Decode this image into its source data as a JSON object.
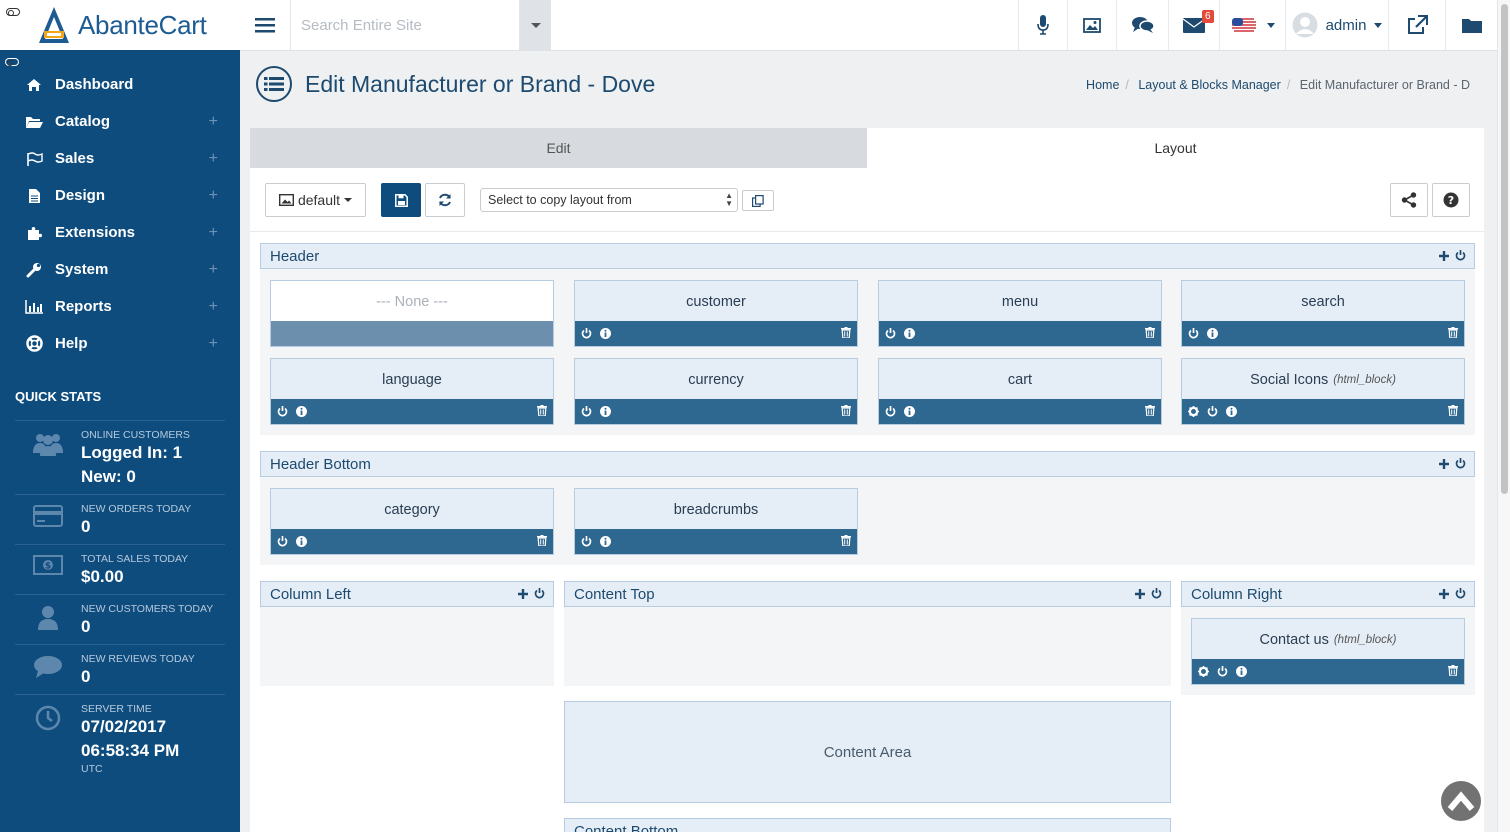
{
  "brand": {
    "name": "AbanteCart"
  },
  "sidebar": {
    "menu": [
      {
        "label": "Dashboard",
        "icon": "home-icon",
        "expandable": false
      },
      {
        "label": "Catalog",
        "icon": "folder-open-icon",
        "expandable": true
      },
      {
        "label": "Sales",
        "icon": "flag-icon",
        "expandable": true
      },
      {
        "label": "Design",
        "icon": "file-icon",
        "expandable": true
      },
      {
        "label": "Extensions",
        "icon": "puzzle-icon",
        "expandable": true
      },
      {
        "label": "System",
        "icon": "wrench-icon",
        "expandable": true
      },
      {
        "label": "Reports",
        "icon": "bar-chart-icon",
        "expandable": true
      },
      {
        "label": "Help",
        "icon": "lifebuoy-icon",
        "expandable": true
      }
    ],
    "expand_symbol": "+",
    "quick_stats": {
      "title": "QUICK STATS",
      "online": {
        "label": "ONLINE CUSTOMERS",
        "logged_in": "Logged In: 1",
        "new": "New: 0"
      },
      "orders": {
        "label": "NEW ORDERS TODAY",
        "value": "0"
      },
      "sales": {
        "label": "TOTAL SALES TODAY",
        "value": "$0.00"
      },
      "customers": {
        "label": "NEW CUSTOMERS TODAY",
        "value": "0"
      },
      "reviews": {
        "label": "NEW REVIEWS TODAY",
        "value": "0"
      },
      "server_time": {
        "label": "SERVER TIME",
        "date": "07/02/2017",
        "time": "06:58:34 PM",
        "tz": "UTC"
      }
    }
  },
  "topbar": {
    "search_placeholder": "Search Entire Site",
    "messages_badge": "6",
    "user": "admin"
  },
  "page": {
    "title": "Edit Manufacturer or Brand - Dove",
    "breadcrumbs": [
      "Home",
      "Layout & Blocks Manager",
      "Edit Manufacturer or Brand - D"
    ]
  },
  "tabs": [
    "Edit",
    "Layout"
  ],
  "toolbar": {
    "template": "default",
    "copy_placeholder": "Select to copy layout from"
  },
  "sections": {
    "header": {
      "title": "Header",
      "blocks": [
        "--- None ---",
        "customer",
        "menu",
        "search",
        "language",
        "currency",
        "cart",
        "Social Icons"
      ]
    },
    "header_bottom": {
      "title": "Header Bottom",
      "blocks": [
        "category",
        "breadcrumbs"
      ]
    },
    "column_left": {
      "title": "Column Left"
    },
    "content_top": {
      "title": "Content Top"
    },
    "column_right": {
      "title": "Column Right",
      "blocks": [
        "Contact us"
      ]
    },
    "content_area": "Content Area",
    "content_bottom": "Content Bottom"
  },
  "block_type_note": "(html_block)",
  "colors": {
    "sidebar": "#0e4c7e",
    "block_bar": "#2e6790",
    "section_head": "#e5eef7"
  }
}
